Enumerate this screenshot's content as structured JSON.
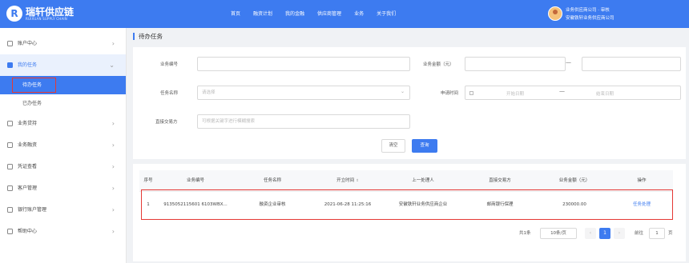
{
  "brand": {
    "logo_mark": "R",
    "name": "瑞轩供应链",
    "subtitle": "RUIXUAN SUPPLY CHAIN"
  },
  "nav": [
    "首页",
    "融资计划",
    "我的金融",
    "供应商管理",
    "业务",
    "关于我们"
  ],
  "user": {
    "line1": "业务供应商公司 · 审核",
    "line2": "安徽铁轩业务供应商公司",
    "avatar_icon": "user-avatar"
  },
  "sidebar": {
    "items": [
      {
        "label": "账户中心",
        "icon": "user-icon",
        "arrow": "›"
      },
      {
        "label": "我的任务",
        "icon": "task-icon",
        "arrow": "⌄"
      },
      {
        "label": "业务贷持",
        "icon": "loan-icon",
        "arrow": "›"
      },
      {
        "label": "业务融资",
        "icon": "finance-icon",
        "arrow": "›"
      },
      {
        "label": "凭证查看",
        "icon": "voucher-icon",
        "arrow": "›"
      },
      {
        "label": "客户管理",
        "icon": "customer-icon",
        "arrow": "›"
      },
      {
        "label": "银行账户管理",
        "icon": "bank-icon",
        "arrow": "›"
      },
      {
        "label": "帮助中心",
        "icon": "help-icon",
        "arrow": "›"
      }
    ],
    "subitems": [
      {
        "label": "待办任务"
      },
      {
        "label": "已办任务"
      }
    ]
  },
  "breadcrumb": "待办任务",
  "form": {
    "business_no_label": "业务编号",
    "amount_label": "业务金额（元）",
    "task_name_label": "任务名称",
    "task_name_placeholder": "请选择",
    "apply_time_label": "申请时间",
    "start_date": "开始日期",
    "end_date": "结束日期",
    "counterparty_label": "直接交易方",
    "counterparty_placeholder": "可根据关键字进行模糊搜索",
    "dash": "—",
    "reset_label": "清空",
    "search_label": "查询"
  },
  "table": {
    "headers": [
      "序号",
      "业务编号",
      "任务名称",
      "开立时间",
      "上一处理人",
      "直接交易方",
      "业务金额（元）",
      "操作"
    ],
    "sort_icon": "⇕",
    "rows": [
      {
        "index": "1",
        "business_no": "9135052115601 6103WBX...",
        "task_name": "融资企业审核",
        "time": "2021-06-28 11:25:16",
        "prev_handler": "安徽铁轩业务供应商企业",
        "counterparty": "邮商银行保理",
        "amount": "230000.00",
        "action": "任务处理"
      }
    ]
  },
  "pagination": {
    "total": "共1条",
    "page_size": "10条/页",
    "prev": "‹",
    "current": "1",
    "next": "›",
    "goto_label": "前往",
    "goto_value": "1",
    "page_unit": "页"
  }
}
